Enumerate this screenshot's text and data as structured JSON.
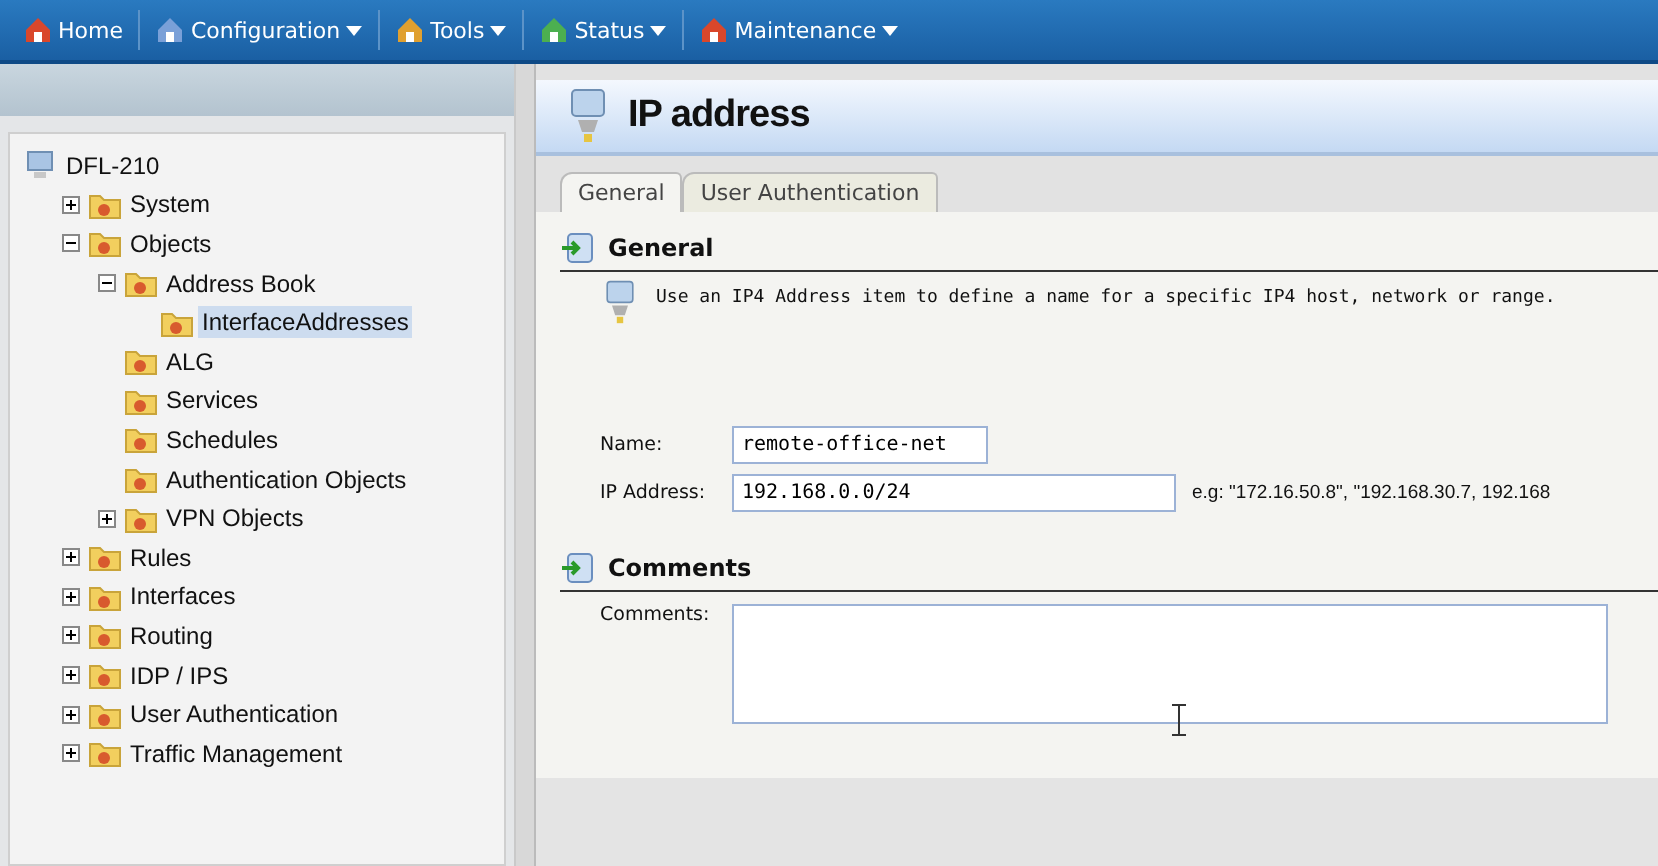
{
  "menu_bar": [
    {
      "label": "Home",
      "has_menu": false
    },
    {
      "label": "Configuration",
      "has_menu": true
    },
    {
      "label": "Tools",
      "has_menu": true
    },
    {
      "label": "Status",
      "has_menu": true
    },
    {
      "label": "Maintenance",
      "has_menu": true
    }
  ],
  "tree": [
    {
      "label": "DFL-210",
      "selected": false,
      "children": [
        {
          "label": "System",
          "selected": false,
          "expanded": false
        },
        {
          "label": "Objects",
          "selected": false,
          "expanded": true,
          "children": [
            {
              "label": "Address Book",
              "selected": false,
              "expanded": true,
              "children": [
                {
                  "label": "InterfaceAddresses",
                  "selected": true
                }
              ]
            },
            {
              "label": "ALG",
              "selected": false
            },
            {
              "label": "Services",
              "selected": false
            },
            {
              "label": "Schedules",
              "selected": false
            },
            {
              "label": "Authentication Objects",
              "selected": false
            },
            {
              "label": "VPN Objects",
              "selected": false,
              "expanded": false
            }
          ]
        },
        {
          "label": "Rules",
          "selected": false,
          "expanded": false
        },
        {
          "label": "Interfaces",
          "selected": false,
          "expanded": false
        },
        {
          "label": "Routing",
          "selected": false,
          "expanded": false
        },
        {
          "label": "IDP / IPS",
          "selected": false,
          "expanded": false
        },
        {
          "label": "User Authentication",
          "selected": false,
          "expanded": false
        },
        {
          "label": "Traffic Management",
          "selected": false,
          "expanded": false
        }
      ]
    }
  ],
  "page_title": "IP address",
  "tabs": [
    {
      "label": "General",
      "selected": true
    },
    {
      "label": "User Authentication",
      "selected": false
    }
  ],
  "general_section": {
    "title": "General",
    "description": "Use an IP4 Address item to define a name for a specific IP4 host, network or range.",
    "fields": [
      {
        "label": "Name:",
        "value": "remote-office-net"
      },
      {
        "label": "IP Address:",
        "value": "192.168.0.0/24",
        "hint": "e.g: \"172.16.50.8\", \"192.168.30.7, 192.168"
      }
    ]
  },
  "comments_section": {
    "title": "Comments",
    "label": "Comments:"
  }
}
